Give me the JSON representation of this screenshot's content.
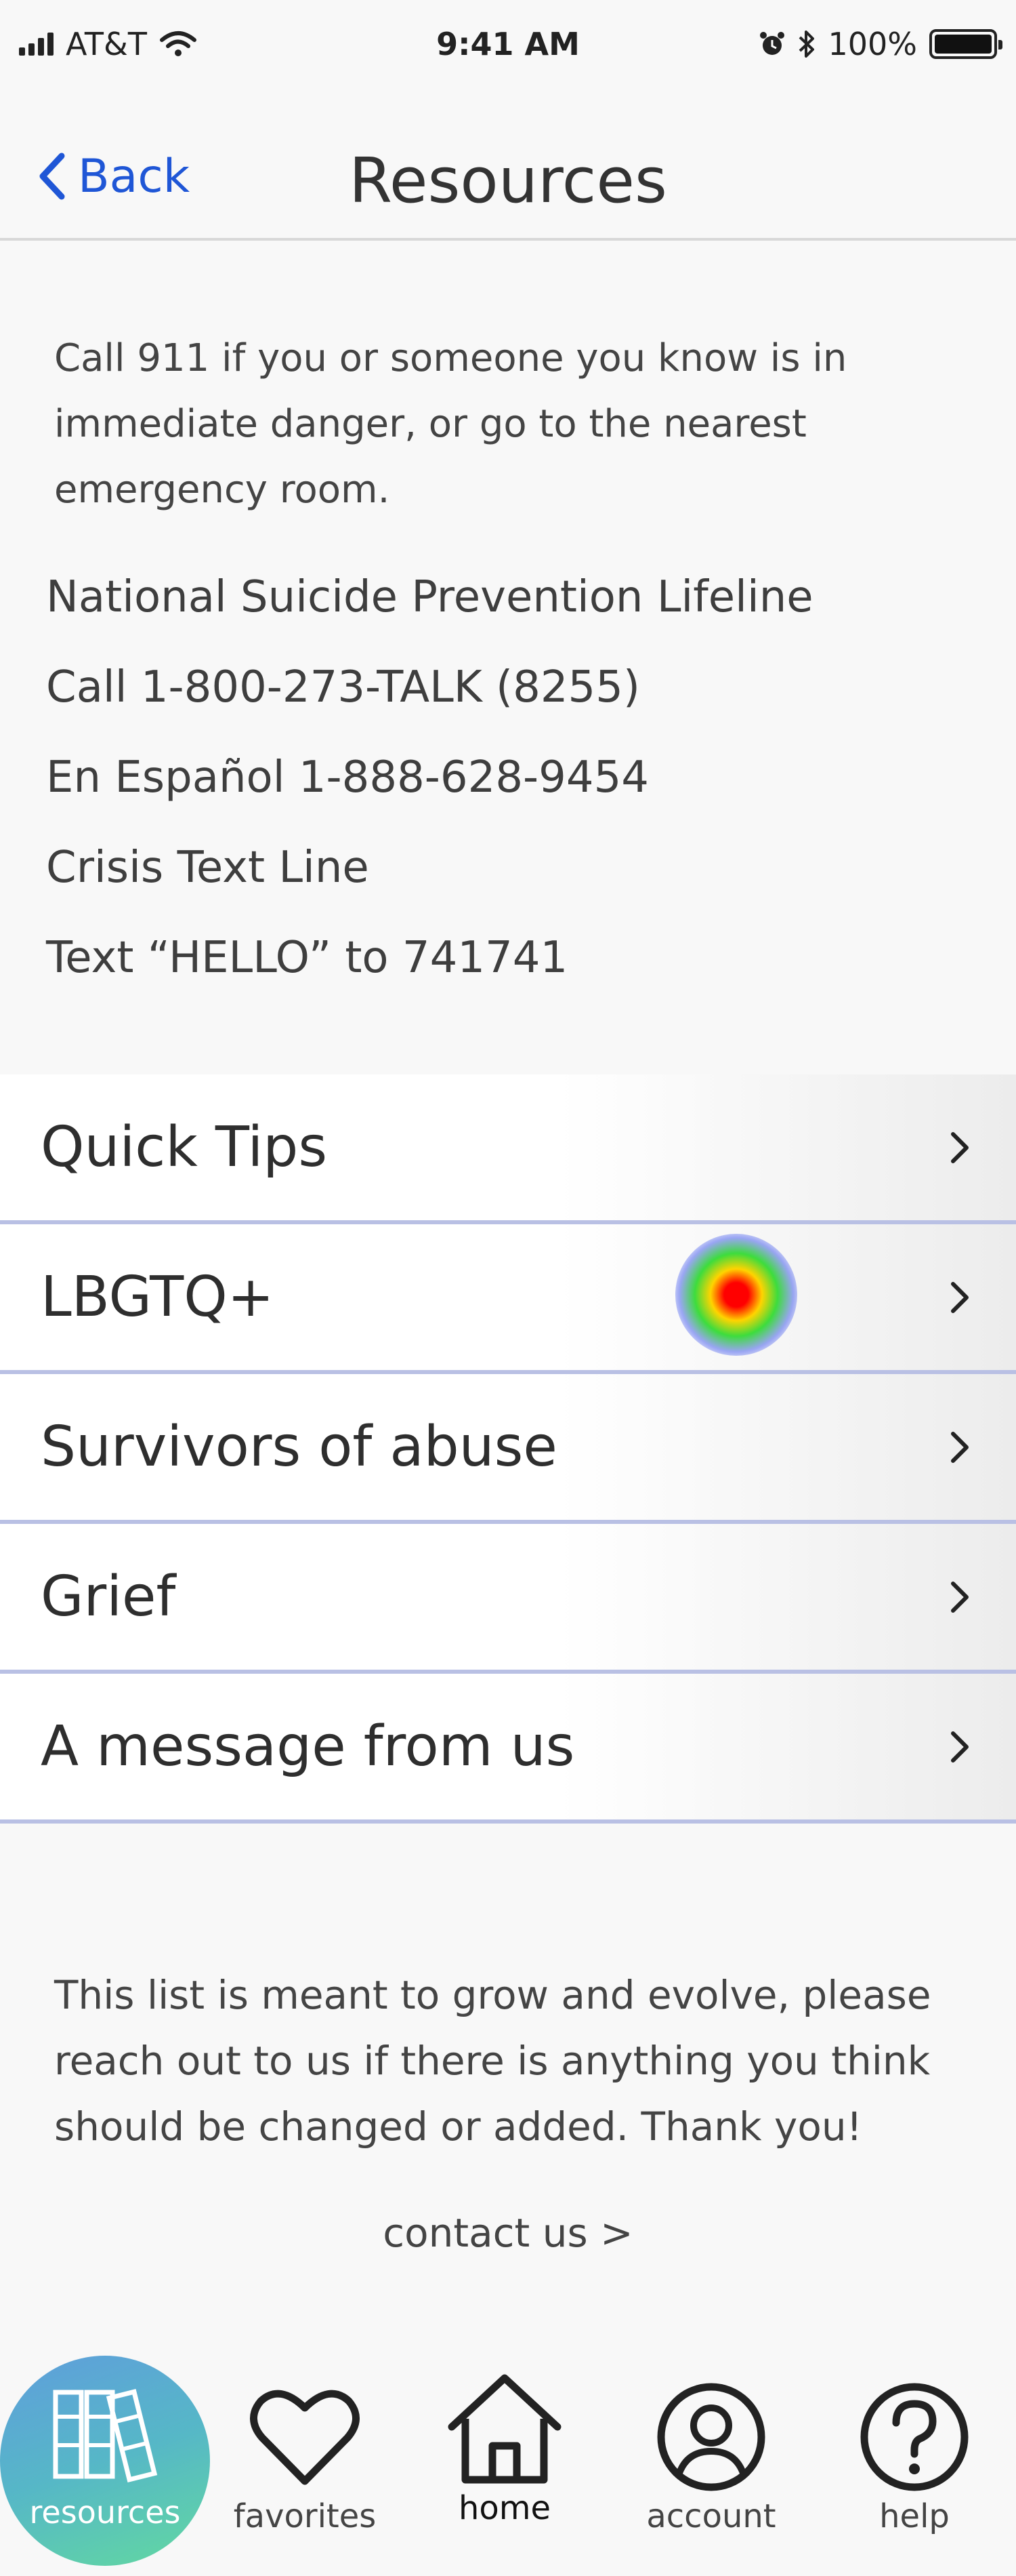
{
  "status_bar": {
    "carrier": "AT&T",
    "time": "9:41 AM",
    "battery": "100%",
    "icons": [
      "signal-icon",
      "wifi-icon",
      "alarm-icon",
      "bluetooth-icon",
      "battery-icon"
    ]
  },
  "nav": {
    "back_label": "Back",
    "title": "Resources"
  },
  "emergency": {
    "text": "Call 911 if you or someone you know is in immediate danger, or go to the nearest emergency room."
  },
  "hotlines": [
    "National Suicide Prevention Lifeline",
    "Call 1-800-273-TALK (8255)",
    "En Español 1-888-628-9454",
    "Crisis Text Line",
    "Text “HELLO” to 741741"
  ],
  "resources": [
    {
      "label": "Quick Tips"
    },
    {
      "label": "LBGTQ+"
    },
    {
      "label": "Survivors of abuse"
    },
    {
      "label": "Grief"
    },
    {
      "label": "A message from us"
    }
  ],
  "footer": {
    "note": "This list is meant to grow and evolve, please reach out to us if there is anything you think should be changed or added. Thank you!",
    "contact_label": "contact us >"
  },
  "tabs": {
    "resources": "resources",
    "favorites": "favorites",
    "home": "home",
    "account": "account",
    "help": "help",
    "active": "resources"
  },
  "colors": {
    "link_blue": "#1f56d6",
    "divider": "#b9c0e4",
    "active_tab_gradient": [
      "#5f9edc",
      "#62d9a0"
    ]
  }
}
